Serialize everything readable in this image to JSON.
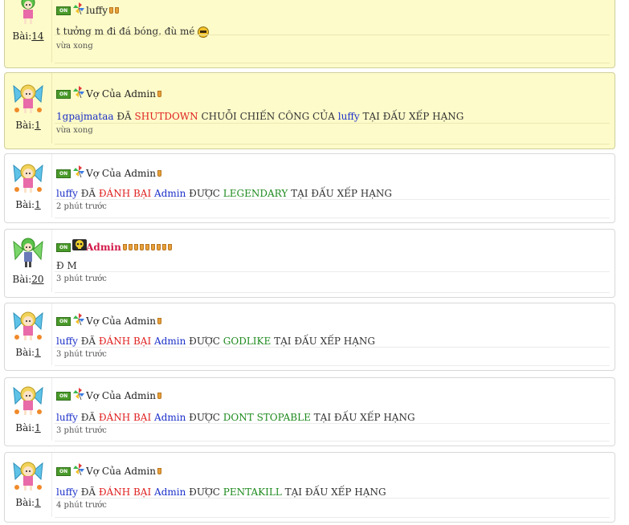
{
  "posts": [
    {
      "count_label": "Bài:",
      "count": "14",
      "user": "luffy",
      "time": "vừa xong",
      "msg": [
        {
          "t": "t tưởng m đi đá bóng, đù mé",
          "c": ""
        }
      ],
      "emoji": true,
      "cups": 2,
      "highlight": true,
      "avatar": "green"
    },
    {
      "count_label": "Bài:",
      "count": "1",
      "user": "Vợ Của Admin",
      "time": "vừa xong",
      "msg": [
        {
          "t": "1gpajmataa",
          "c": "b"
        },
        {
          "t": " ĐÃ ",
          "c": ""
        },
        {
          "t": "SHUTDOWN",
          "c": "r"
        },
        {
          "t": " CHUỖI CHIẾN CÔNG CỦA ",
          "c": ""
        },
        {
          "t": "luffy",
          "c": "b"
        },
        {
          "t": " TẠI ĐẤU XẾP HẠNG",
          "c": ""
        }
      ],
      "cups": 1,
      "highlight": true,
      "avatar": "fairy"
    },
    {
      "count_label": "Bài:",
      "count": "1",
      "user": "Vợ Của Admin",
      "time": "2 phút trước",
      "msg": [
        {
          "t": "luffy",
          "c": "b"
        },
        {
          "t": " ĐÃ ",
          "c": ""
        },
        {
          "t": "ĐÁNH BẠI",
          "c": "r"
        },
        {
          "t": " ",
          "c": ""
        },
        {
          "t": "Admin",
          "c": "b"
        },
        {
          "t": " ĐƯỢC ",
          "c": ""
        },
        {
          "t": "LEGENDARY",
          "c": "g"
        },
        {
          "t": " TẠI ĐẤU XẾP HẠNG",
          "c": ""
        }
      ],
      "cups": 1,
      "highlight": false,
      "avatar": "fairy"
    },
    {
      "count_label": "Bài:",
      "count": "20",
      "user": "Admin",
      "time": "3 phút trước",
      "msg": [
        {
          "t": "Đ M",
          "c": ""
        }
      ],
      "cups": 9,
      "highlight": false,
      "avatar": "green-wing",
      "admin": true
    },
    {
      "count_label": "Bài:",
      "count": "1",
      "user": "Vợ Của Admin",
      "time": "3 phút trước",
      "msg": [
        {
          "t": "luffy",
          "c": "b"
        },
        {
          "t": " ĐÃ ",
          "c": ""
        },
        {
          "t": "ĐÁNH BẠI",
          "c": "r"
        },
        {
          "t": " ",
          "c": ""
        },
        {
          "t": "Admin",
          "c": "b"
        },
        {
          "t": " ĐƯỢC ",
          "c": ""
        },
        {
          "t": "GODLIKE",
          "c": "g"
        },
        {
          "t": " TẠI ĐẤU XẾP HẠNG",
          "c": ""
        }
      ],
      "cups": 1,
      "highlight": false,
      "avatar": "fairy"
    },
    {
      "count_label": "Bài:",
      "count": "1",
      "user": "Vợ Của Admin",
      "time": "3 phút trước",
      "msg": [
        {
          "t": "luffy",
          "c": "b"
        },
        {
          "t": " ĐÃ ",
          "c": ""
        },
        {
          "t": "ĐÁNH BẠI",
          "c": "r"
        },
        {
          "t": " ",
          "c": ""
        },
        {
          "t": "Admin",
          "c": "b"
        },
        {
          "t": " ĐƯỢC ",
          "c": ""
        },
        {
          "t": "DONT STOPABLE",
          "c": "g"
        },
        {
          "t": " TẠI ĐẤU XẾP HẠNG",
          "c": ""
        }
      ],
      "cups": 1,
      "highlight": false,
      "avatar": "fairy"
    },
    {
      "count_label": "Bài:",
      "count": "1",
      "user": "Vợ Của Admin",
      "time": "4 phút trước",
      "msg": [
        {
          "t": "luffy",
          "c": "b"
        },
        {
          "t": " ĐÃ ",
          "c": ""
        },
        {
          "t": "ĐÁNH BẠI",
          "c": "r"
        },
        {
          "t": " ",
          "c": ""
        },
        {
          "t": "Admin",
          "c": "b"
        },
        {
          "t": " ĐƯỢC ",
          "c": ""
        },
        {
          "t": "PENTAKILL",
          "c": "g"
        },
        {
          "t": " TẠI ĐẤU XẾP HẠNG",
          "c": ""
        }
      ],
      "cups": 1,
      "highlight": false,
      "avatar": "fairy"
    }
  ],
  "online_badge": "ON"
}
